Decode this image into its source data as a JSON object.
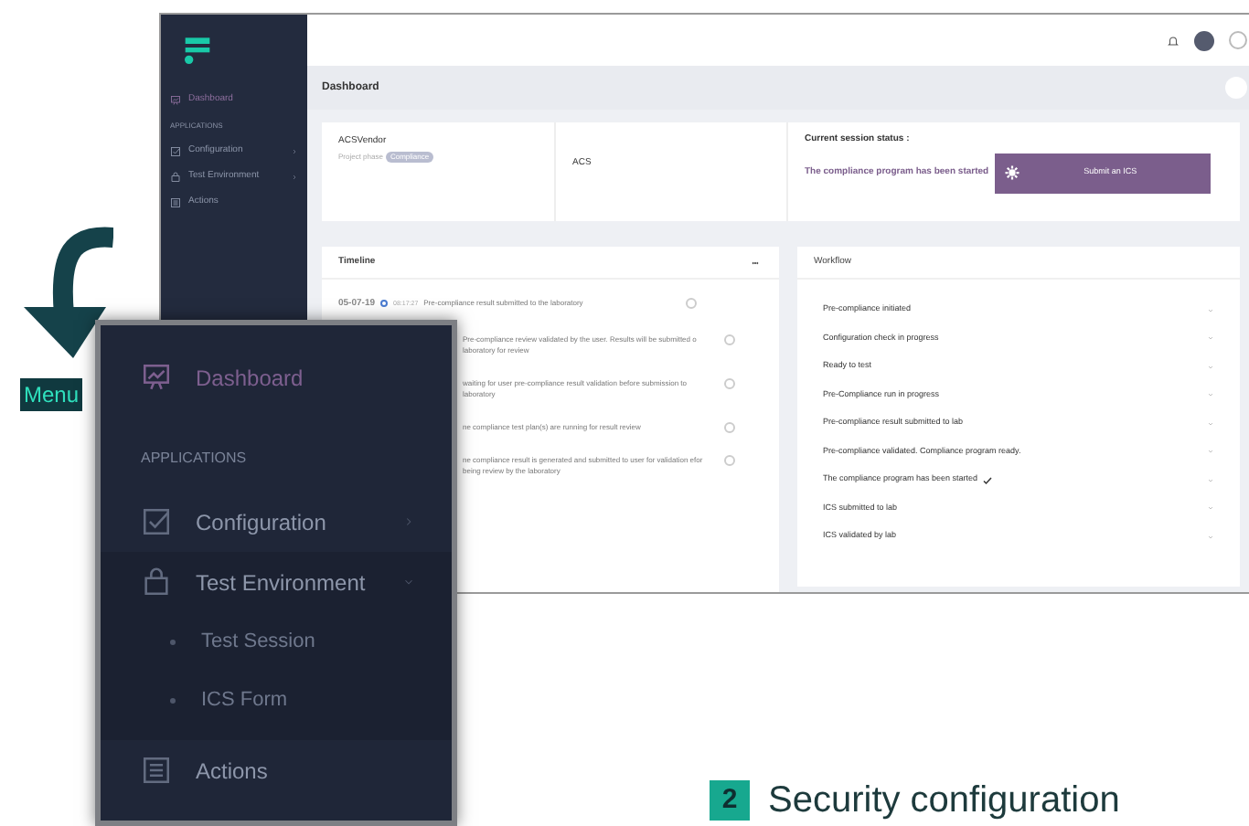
{
  "app": {
    "sidebar": {
      "items": [
        {
          "kind": "link",
          "label": "Dashboard",
          "selected": true
        },
        {
          "kind": "heading",
          "label": "APPLICATIONS"
        },
        {
          "kind": "group",
          "label": "Configuration",
          "expanded": false
        },
        {
          "kind": "group",
          "label": "Test Environment",
          "expanded": false
        },
        {
          "kind": "link",
          "label": "Actions",
          "selected": false
        }
      ]
    },
    "page_title": "Dashboard",
    "vendor_card": {
      "title": "ACSVendor",
      "phase_label": "Project phase",
      "phase_badge": "Compliance"
    },
    "acs_card": {
      "title": "ACS"
    },
    "status_card": {
      "title": "Current session status :",
      "status": "The compliance program has been started",
      "button": "Submit an ICS"
    },
    "timeline": {
      "title": "Timeline",
      "entries": [
        {
          "date": "05-07-19",
          "time": "08:17:27",
          "text": "Pre-compliance result submitted to the laboratory"
        },
        {
          "text": "Pre-compliance review validated by the user. Results will be submitted o laboratory for review"
        },
        {
          "text": "waiting for user pre-compliance result validation before submission to laboratory"
        },
        {
          "text": "ne compliance test plan(s) are running for result review"
        },
        {
          "text": "ne compliance result is generated and submitted to user for validation efor being review by the laboratory"
        }
      ]
    },
    "workflow": {
      "title": "Workflow",
      "steps": [
        {
          "label": "Pre-compliance initiated",
          "checked": false
        },
        {
          "label": "Configuration check in progress",
          "checked": false
        },
        {
          "label": "Ready to test",
          "checked": false
        },
        {
          "label": "Pre-Compliance run in progress",
          "checked": false
        },
        {
          "label": "Pre-compliance result submitted to lab",
          "checked": false
        },
        {
          "label": "Pre-compliance validated. Compliance program ready.",
          "checked": false
        },
        {
          "label": "The compliance program has been started",
          "checked": true
        },
        {
          "label": "ICS submitted to lab",
          "checked": false
        },
        {
          "label": "ICS validated by lab",
          "checked": false
        }
      ]
    }
  },
  "menu_zoom": {
    "items": [
      {
        "kind": "link",
        "label": "Dashboard",
        "selected": true
      },
      {
        "kind": "heading",
        "label": "APPLICATIONS"
      },
      {
        "kind": "group",
        "label": "Configuration",
        "expanded": false
      },
      {
        "kind": "group",
        "label": "Test Environment",
        "expanded": true,
        "children": [
          {
            "label": "Test Session"
          },
          {
            "label": "ICS Form"
          }
        ]
      },
      {
        "kind": "link",
        "label": "Actions",
        "selected": false
      }
    ]
  },
  "callout": {
    "label": "Menu"
  },
  "caption": {
    "number": "2",
    "text": "Security configuration"
  }
}
